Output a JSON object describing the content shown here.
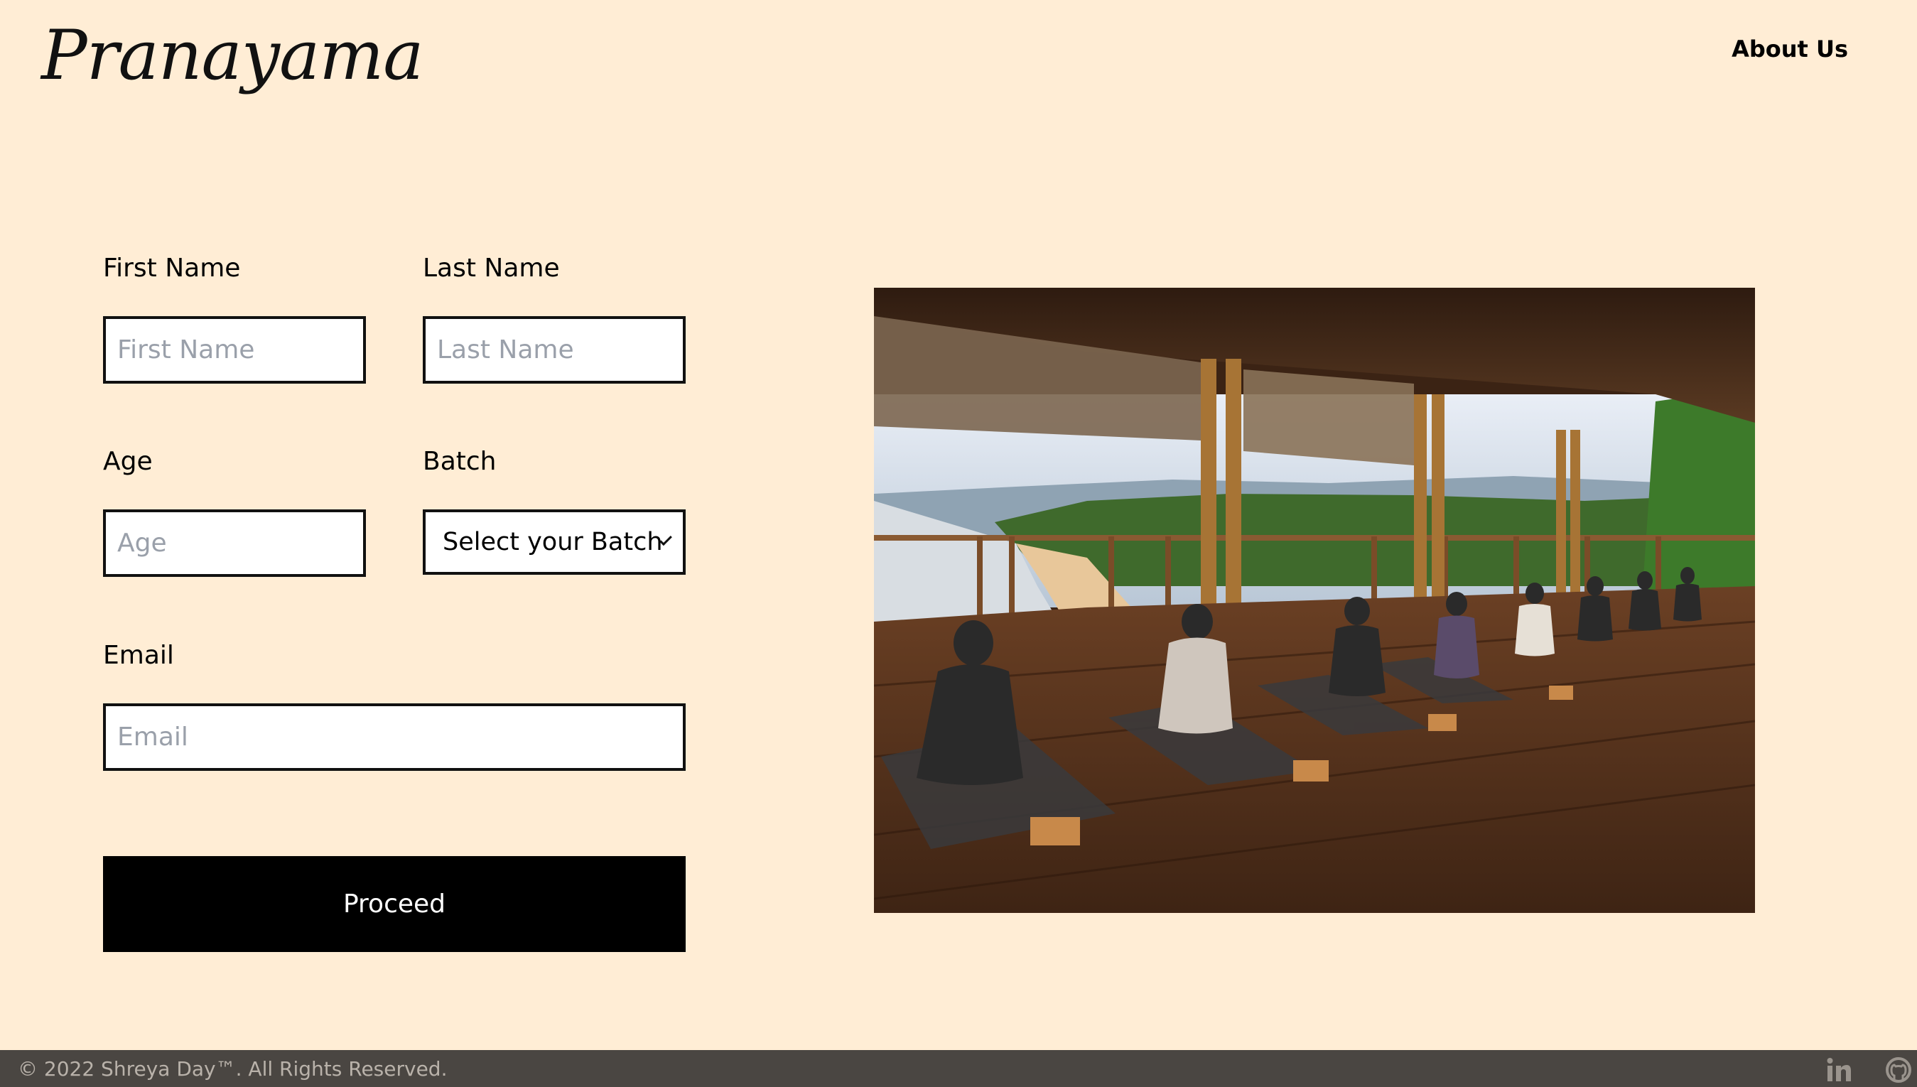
{
  "header": {
    "brand": "Pranayama",
    "nav_about": "About Us"
  },
  "form": {
    "first_name": {
      "label": "First Name",
      "placeholder": "First Name",
      "value": ""
    },
    "last_name": {
      "label": "Last Name",
      "placeholder": "Last Name",
      "value": ""
    },
    "age": {
      "label": "Age",
      "placeholder": "Age",
      "value": ""
    },
    "batch": {
      "label": "Batch",
      "selected": "Select your Batch"
    },
    "email": {
      "label": "Email",
      "placeholder": "Email",
      "value": ""
    },
    "proceed_label": "Proceed"
  },
  "hero_image": {
    "icon": "yoga-class-photo"
  },
  "footer": {
    "copyright": "© 2022 Shreya Day™. All Rights Reserved.",
    "social_icons": [
      "linkedin-icon",
      "github-icon"
    ]
  },
  "colors": {
    "background": "#ffedd5",
    "button": "#000000",
    "footer": "#4a4642",
    "footer_text": "#b9b2aa"
  }
}
